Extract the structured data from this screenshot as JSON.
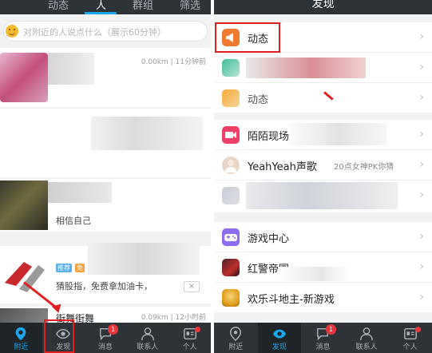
{
  "left": {
    "header": {
      "tabs": [
        {
          "label": "动态"
        },
        {
          "label": "人"
        },
        {
          "label": "群组"
        },
        {
          "label": "筛选"
        }
      ]
    },
    "search": {
      "placeholder": "对附近的人说点什么（展示60分钟）"
    },
    "feed": [
      {
        "meta": "0.00km | 11分钟前"
      },
      {
        "text": "相信自己"
      },
      {
        "tags": [
          "推荐",
          "免"
        ],
        "text": "猜股指，免费拿加油卡，",
        "close": "×"
      },
      {
        "title": "街舞街舞",
        "meta": "0.09km | 12小时前"
      }
    ]
  },
  "right": {
    "header": {
      "title": "发现"
    },
    "rows": [
      {
        "label": "动态",
        "icon": "megaphone-icon",
        "color": "#f07a2e"
      },
      {
        "label": "",
        "icon": "blurred-icon",
        "color": "#3fbf9b"
      },
      {
        "label": "动态",
        "icon": "blurred-icon",
        "color": "#f4a93a"
      },
      {
        "label": "陌陌现场",
        "icon": "live-camera-icon",
        "color": "#f0406a"
      },
      {
        "label": "YeahYeah声歌",
        "sub": "20点女神PK你猜",
        "icon": "avatar-icon",
        "color": "#e9d6c7"
      },
      {
        "label": "",
        "icon": "blurred-icon",
        "color": "#c9ccd6"
      },
      {
        "label": "游戏中心",
        "icon": "gamepad-icon",
        "color": "#8c6cf0"
      },
      {
        "label": "红警帝国",
        "icon": "game-thumb-icon",
        "color": "#4a2020"
      },
      {
        "label": "欢乐斗地主-新游戏",
        "icon": "game-thumb-icon",
        "color": "#e2a11c"
      }
    ],
    "chevron": "›"
  },
  "nav": {
    "items": [
      {
        "label": "附近",
        "icon": "location-pin-icon"
      },
      {
        "label": "发现",
        "icon": "eye-icon"
      },
      {
        "label": "消息",
        "icon": "chat-bubble-icon",
        "badge": "1"
      },
      {
        "label": "联系人",
        "icon": "person-icon"
      },
      {
        "label": "个人",
        "icon": "profile-card-icon",
        "dot": true
      }
    ]
  },
  "colors": {
    "nav_bg": "#2e3338",
    "accent": "#1aa7ec",
    "badge": "#e8363b",
    "annotation": "#e02020"
  }
}
